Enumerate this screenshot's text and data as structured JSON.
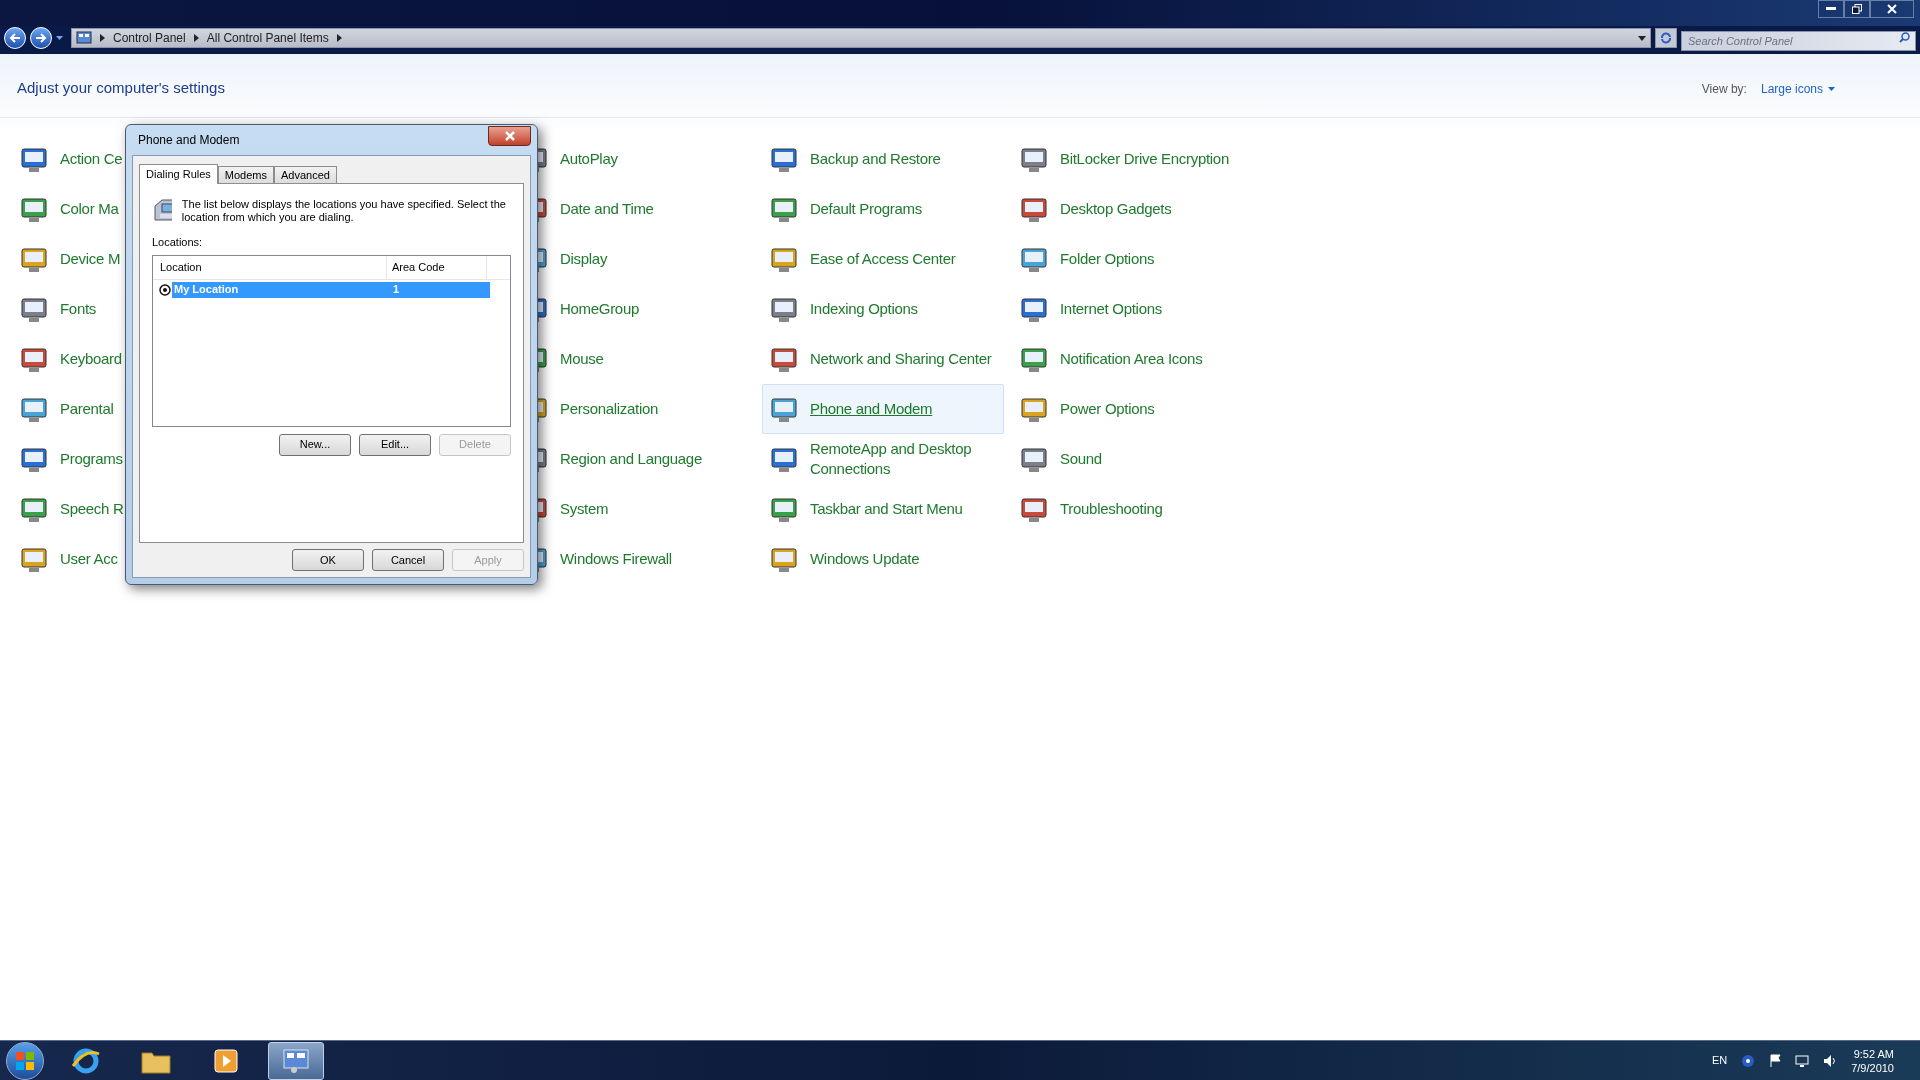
{
  "window": {
    "breadcrumb": [
      "Control Panel",
      "All Control Panel Items"
    ],
    "search": {
      "placeholder": "Search Control Panel"
    }
  },
  "header": {
    "title": "Adjust your computer's settings",
    "view_by_label": "View by:",
    "view_by_value": "Large icons"
  },
  "columns": [
    {
      "items": [
        {
          "label": "Action Ce",
          "highlighted": false
        },
        {
          "label": "Color Ma",
          "highlighted": false
        },
        {
          "label": "Device M",
          "highlighted": false
        },
        {
          "label": "Fonts",
          "highlighted": false
        },
        {
          "label": "Keyboard",
          "highlighted": false
        },
        {
          "label": "Parental",
          "highlighted": false
        },
        {
          "label": "Programs",
          "highlighted": false
        },
        {
          "label": "Speech R",
          "highlighted": false
        },
        {
          "label": "User Acc",
          "highlighted": false
        }
      ]
    },
    {
      "items": [
        {
          "label": "AutoPlay",
          "highlighted": false
        },
        {
          "label": "Date and Time",
          "highlighted": false
        },
        {
          "label": "Display",
          "highlighted": false
        },
        {
          "label": "HomeGroup",
          "highlighted": false
        },
        {
          "label": "Mouse",
          "highlighted": false
        },
        {
          "label": "Personalization",
          "highlighted": false
        },
        {
          "label": "Region and Language",
          "highlighted": false
        },
        {
          "label": "System",
          "highlighted": false
        },
        {
          "label": "Windows Firewall",
          "highlighted": false
        }
      ]
    },
    {
      "items": [
        {
          "label": "Backup and Restore",
          "highlighted": false
        },
        {
          "label": "Default Programs",
          "highlighted": false
        },
        {
          "label": "Ease of Access Center",
          "highlighted": false
        },
        {
          "label": "Indexing Options",
          "highlighted": false
        },
        {
          "label": "Network and Sharing Center",
          "highlighted": false
        },
        {
          "label": "Phone and Modem",
          "highlighted": true
        },
        {
          "label": "RemoteApp and Desktop Connections",
          "highlighted": false
        },
        {
          "label": "Taskbar and Start Menu",
          "highlighted": false
        },
        {
          "label": "Windows Update",
          "highlighted": false
        }
      ]
    },
    {
      "items": [
        {
          "label": "BitLocker Drive Encryption",
          "highlighted": false
        },
        {
          "label": "Desktop Gadgets",
          "highlighted": false
        },
        {
          "label": "Folder Options",
          "highlighted": false
        },
        {
          "label": "Internet Options",
          "highlighted": false
        },
        {
          "label": "Notification Area Icons",
          "highlighted": false
        },
        {
          "label": "Power Options",
          "highlighted": false
        },
        {
          "label": "Sound",
          "highlighted": false
        },
        {
          "label": "Troubleshooting",
          "highlighted": false
        }
      ]
    }
  ],
  "dialog": {
    "title": "Phone and Modem",
    "tabs": [
      {
        "label": "Dialing Rules",
        "selected": true
      },
      {
        "label": "Modems",
        "selected": false
      },
      {
        "label": "Advanced",
        "selected": false
      }
    ],
    "description": "The list below displays the locations you have specified. Select the location from which you are dialing.",
    "locations_label": "Locations:",
    "table": {
      "columns": [
        "Location",
        "Area Code"
      ],
      "rows": [
        {
          "location": "My Location",
          "area_code": "1",
          "selected": true
        }
      ]
    },
    "list_buttons": [
      {
        "label": "New...",
        "disabled": false
      },
      {
        "label": "Edit...",
        "disabled": false
      },
      {
        "label": "Delete",
        "disabled": true
      }
    ],
    "buttons": [
      {
        "label": "OK",
        "disabled": false
      },
      {
        "label": "Cancel",
        "disabled": false
      },
      {
        "label": "Apply",
        "disabled": true
      }
    ]
  },
  "taskbar": {
    "apps": [
      {
        "kind": "browser",
        "selected": false
      },
      {
        "kind": "folder",
        "selected": false
      },
      {
        "kind": "media",
        "selected": false
      },
      {
        "kind": "control-panel",
        "selected": true
      }
    ],
    "tray": {
      "language": "EN",
      "time": "9:52 AM",
      "date": "7/9/2010"
    }
  }
}
